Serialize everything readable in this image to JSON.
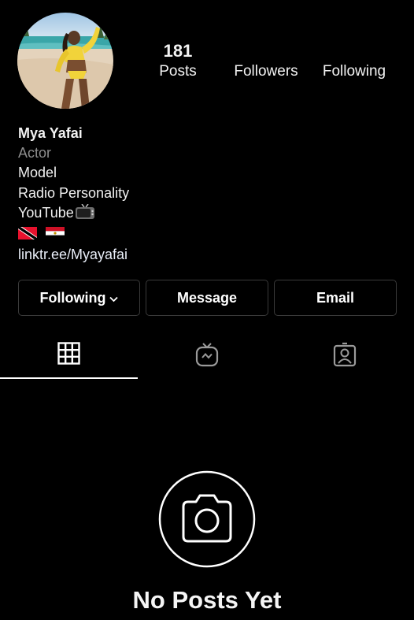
{
  "profile": {
    "name": "Mya Yafai",
    "category": "Actor",
    "bio_lines": [
      "Model",
      "Radio Personality",
      "YouTube"
    ],
    "bio_emoji": "tv-emoji",
    "flags": [
      "trinidad-tobago-flag",
      "egypt-flag"
    ],
    "link": "linktr.ee/Myayafai"
  },
  "stats": {
    "posts_count": "181",
    "posts_label": "Posts",
    "followers_label": "Followers",
    "following_label": "Following"
  },
  "actions": {
    "following_label": "Following",
    "message_label": "Message",
    "email_label": "Email"
  },
  "tabs": [
    {
      "icon": "grid-icon",
      "active": true
    },
    {
      "icon": "igtv-icon",
      "active": false
    },
    {
      "icon": "tagged-icon",
      "active": false
    }
  ],
  "empty_state": {
    "icon": "camera-icon",
    "title": "No Posts Yet"
  },
  "colors": {
    "background": "#000000",
    "text": "#ffffff",
    "muted": "#8e8e8e",
    "border": "#3a3a3a"
  }
}
